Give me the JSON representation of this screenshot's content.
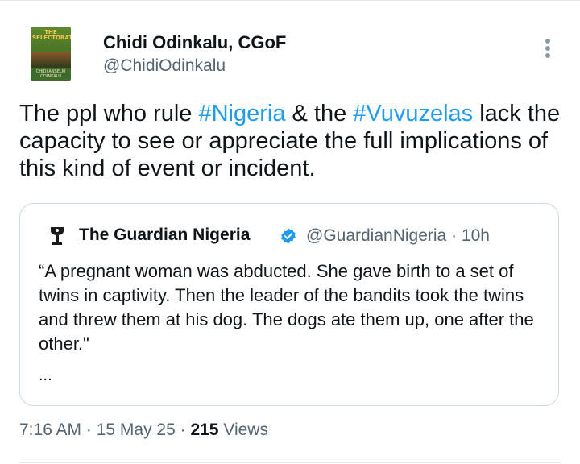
{
  "author": {
    "name": "Chidi Odinkalu, CGoF",
    "handle": "@ChidiOdinkalu",
    "avatar": {
      "book_title": "THE SELECTORATE",
      "book_author": "CHIDI ANSELM ODINKALU"
    }
  },
  "tweet": {
    "parts": [
      "The ppl who rule ",
      "#Nigeria",
      " & the ",
      "#Vuvuzelas",
      " lack the capacity to see or appreciate the full implications of this kind of event or incident."
    ]
  },
  "quote": {
    "name": "The Guardian Nigeria",
    "handle_time": "@GuardianNigeria · 10h",
    "text": "“A pregnant woman was abducted. She gave birth to a set of twins in captivity. Then the leader of the bandits took the twins and threw them at his dog. The dogs ate them up, one after the other.\"",
    "ellipsis": "...",
    "verified": true
  },
  "meta": {
    "time_date": "7:16 AM · 15 May 25 · ",
    "views_count": "215",
    "views_label": " Views"
  },
  "icons": {
    "more": "more-vertical-icon",
    "verified": "verified-badge-icon",
    "quote_avatar": "guardian-logo-icon"
  },
  "colors": {
    "link": "#1d9bf0",
    "secondary_text": "#536471",
    "primary_text": "#0f1419",
    "border": "#cfd9de"
  }
}
